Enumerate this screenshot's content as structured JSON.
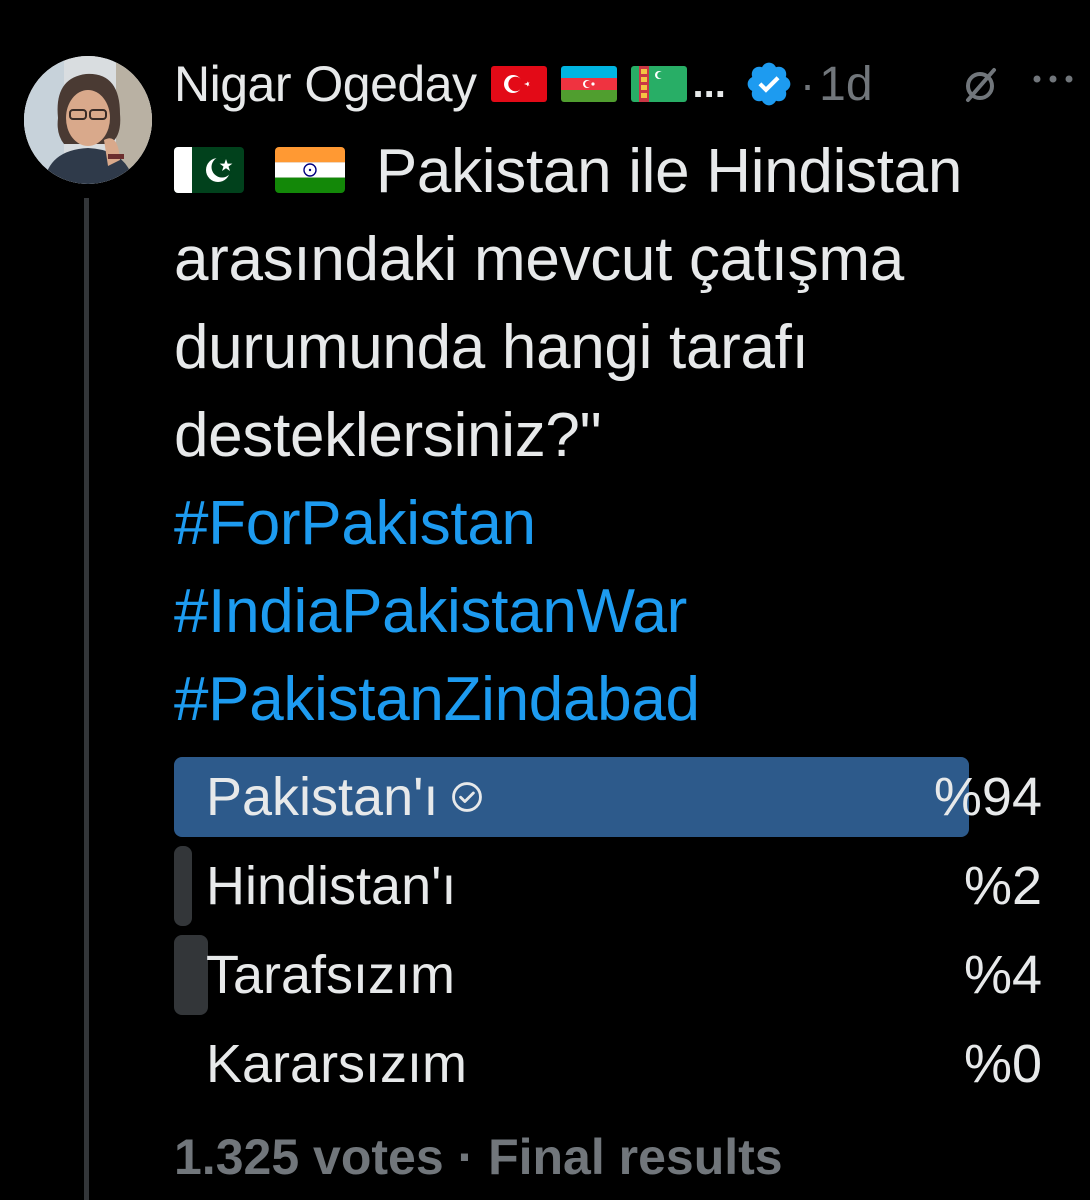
{
  "tweet": {
    "author": {
      "name": "Nigar Ogeday",
      "truncation": "...",
      "verified": true,
      "flags": [
        "turkey-flag",
        "azerbaijan-flag",
        "turkmenistan-flag"
      ]
    },
    "separator": "·",
    "time": "1d",
    "text_flags": [
      "pakistan-flag",
      "india-flag"
    ],
    "text_lines": [
      "Pakistan ile Hindistan",
      "arasındaki mevcut çatışma",
      "durumunda hangi tarafı",
      "desteklersiniz?\""
    ],
    "hashtags": [
      "#ForPakistan",
      "#IndiaPakistanWar",
      "#PakistanZindabad"
    ]
  },
  "poll": {
    "options": [
      {
        "label": "Pakistan'ı",
        "percent_text": "%94",
        "percent": 94,
        "winner": true
      },
      {
        "label": "Hindistan'ı",
        "percent_text": "%2",
        "percent": 2,
        "winner": false
      },
      {
        "label": "Tarafsızım",
        "percent_text": "%4",
        "percent": 4,
        "winner": false
      },
      {
        "label": "Kararsızım",
        "percent_text": "%0",
        "percent": 0,
        "winner": false
      }
    ],
    "footer": "1.325 votes · Final results"
  },
  "colors": {
    "background": "#000000",
    "text": "#e7e9ea",
    "muted": "#71767b",
    "link": "#1d9bf0",
    "winner_bar": "#2d5a8b",
    "bar": "#333639",
    "verified": "#1d9bf0"
  },
  "icons": {
    "verified": "verified-badge-icon",
    "grok": "grok-icon",
    "more": "more-options-icon",
    "check": "check-circle-icon"
  }
}
